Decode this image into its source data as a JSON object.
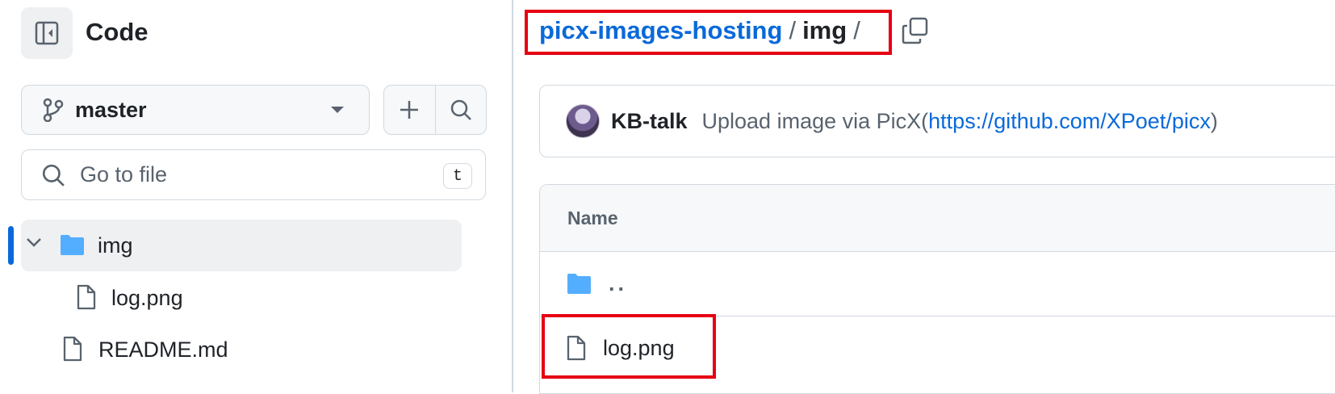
{
  "sidebar": {
    "title": "Code",
    "branch": "master",
    "search_placeholder": "Go to file",
    "search_shortcut": "t",
    "tree": [
      {
        "label": "img",
        "type": "folder",
        "expanded": true,
        "active": true
      },
      {
        "label": "log.png",
        "type": "file"
      },
      {
        "label": "README.md",
        "type": "file"
      }
    ]
  },
  "breadcrumb": {
    "repo": "picx-images-hosting",
    "separator": "/",
    "current": "img",
    "trailing": "/"
  },
  "commit": {
    "author": "KB-talk",
    "message_prefix": "Upload image via PicX(",
    "link": "https://github.com/XPoet/picx",
    "message_suffix": ")"
  },
  "files": {
    "header": "Name",
    "rows": [
      {
        "label": "..",
        "type": "parent"
      },
      {
        "label": "log.png",
        "type": "file"
      }
    ]
  },
  "colors": {
    "link": "#0969da",
    "folder": "#54aeff",
    "highlight": "#e60012"
  }
}
